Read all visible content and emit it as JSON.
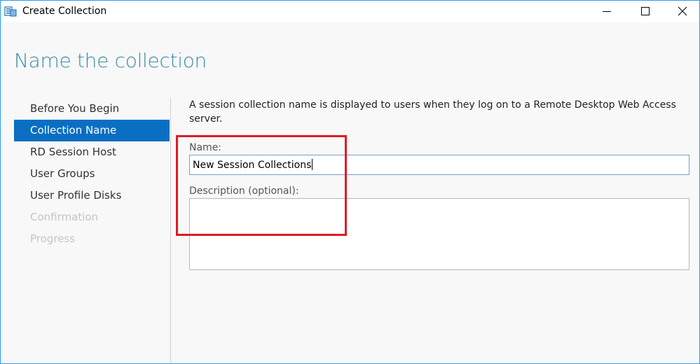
{
  "window": {
    "title": "Create Collection",
    "icon": "server-collection-icon"
  },
  "page": {
    "heading": "Name the collection"
  },
  "nav": {
    "items": [
      {
        "label": "Before You Begin",
        "state": "normal"
      },
      {
        "label": "Collection Name",
        "state": "selected"
      },
      {
        "label": "RD Session Host",
        "state": "normal"
      },
      {
        "label": "User Groups",
        "state": "normal"
      },
      {
        "label": "User Profile Disks",
        "state": "normal"
      },
      {
        "label": "Confirmation",
        "state": "disabled"
      },
      {
        "label": "Progress",
        "state": "disabled"
      }
    ]
  },
  "form": {
    "description": "A session collection name is displayed to users when they log on to a Remote Desktop Web Access server.",
    "name_label": "Name:",
    "name_value": "New Session Collections",
    "description_label": "Description (optional):",
    "description_value": ""
  },
  "colors": {
    "accent": "#0a6fc2",
    "heading": "#3d8ba5",
    "window_border": "#2b9be8",
    "highlight": "#e01b24"
  }
}
